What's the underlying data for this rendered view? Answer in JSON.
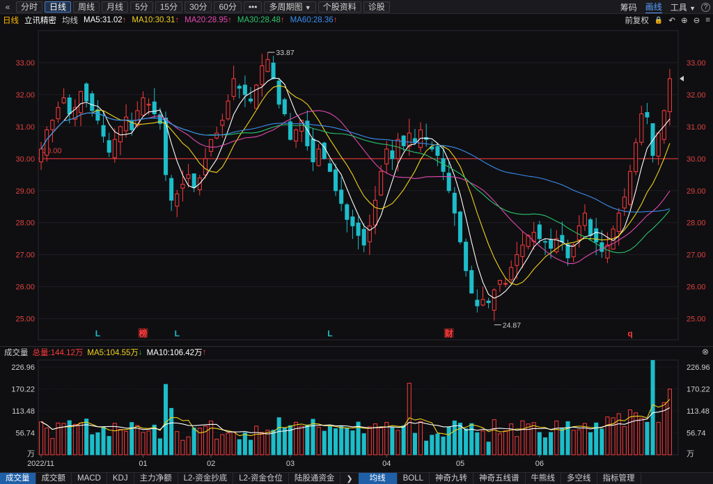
{
  "toolbar": {
    "back_icon": "«",
    "periods": [
      "分时",
      "日线",
      "周线",
      "月线",
      "5分",
      "15分",
      "30分",
      "60分"
    ],
    "active_period": "日线",
    "more": "•••",
    "multi_period": "多周期图",
    "multi_period_arrow": "▼",
    "stock_info": "个股资料",
    "diagnose": "诊股",
    "right_links": [
      "筹码",
      "画线",
      "工具"
    ],
    "active_right": "画线",
    "tools_arrow": "▼",
    "help_icon": "?"
  },
  "ma_row": {
    "period_label": "日线",
    "stock_name": "立讯精密",
    "avg_label": "均线",
    "ma5": "MA5:31.02",
    "ma10": "MA10:30.31",
    "ma20": "MA20:28.95",
    "ma30": "MA30:28.48",
    "ma60": "MA60:28.36",
    "arrow_up": "↑",
    "adjust": "前复权",
    "lock_icon": "🔒",
    "undo_icon": "↶",
    "zoom_in_icon": "⊕",
    "zoom_out_icon": "⊖",
    "menu_icon": "≡"
  },
  "colors": {
    "up": "#ff3b3b",
    "down": "#1dbdc9",
    "ma5": "#ffffff",
    "ma10": "#f2d21b",
    "ma20": "#e449b0",
    "ma30": "#2bc46a",
    "ma60": "#3a8ef0",
    "axis_text": "#e0413e",
    "ref_line": "#ff3b3b"
  },
  "chart_data": {
    "type": "candlestick",
    "y_ticks": [
      "33.00",
      "32.00",
      "31.00",
      "30.00",
      "29.00",
      "28.00",
      "27.00",
      "26.00",
      "25.00"
    ],
    "ylim": [
      24.6,
      34.0
    ],
    "reference_line": 30.0,
    "reference_label": "30.00",
    "max_label": "33.87",
    "min_label": "24.87",
    "x_labels": [
      "2022/11",
      "01",
      "02",
      "03",
      "04",
      "05",
      "06"
    ],
    "markers": [
      {
        "text": "L",
        "color": "#1dbdc9"
      },
      {
        "text": "榜",
        "color": "#ff3b3b"
      },
      {
        "text": "L",
        "color": "#1dbdc9"
      },
      {
        "text": "L",
        "color": "#1dbdc9"
      },
      {
        "text": "财",
        "color": "#ff3b3b"
      },
      {
        "text": "q",
        "color": "#ff3b3b"
      }
    ],
    "closes": [
      30.3,
      30.9,
      31.2,
      31.6,
      31.9,
      31.4,
      31.6,
      32.1,
      31.8,
      31.5,
      31.2,
      30.7,
      30.2,
      30.6,
      31.0,
      31.3,
      30.9,
      31.5,
      31.9,
      31.7,
      31.4,
      31.1,
      29.5,
      28.7,
      28.9,
      29.2,
      29.5,
      29.1,
      29.4,
      30.0,
      30.6,
      30.8,
      31.2,
      31.8,
      32.5,
      32.2,
      32.0,
      31.8,
      32.3,
      32.9,
      33.1,
      32.5,
      31.7,
      31.4,
      30.6,
      30.9,
      31.2,
      30.4,
      29.9,
      30.3,
      30.0,
      29.6,
      29.0,
      28.6,
      28.1,
      27.9,
      27.6,
      27.3,
      27.9,
      28.7,
      29.6,
      30.3,
      30.0,
      30.6,
      30.4,
      30.8,
      30.5,
      30.9,
      30.6,
      30.3,
      30.1,
      29.6,
      29.0,
      28.3,
      27.4,
      26.5,
      25.8,
      25.4,
      25.6,
      25.5,
      25.9,
      26.2,
      26.1,
      26.6,
      27.0,
      27.3,
      27.6,
      27.7,
      27.5,
      27.4,
      27.2,
      27.5,
      27.4,
      26.9,
      27.3,
      27.9,
      28.3,
      27.6,
      27.4,
      27.1,
      27.3,
      27.8,
      28.3,
      28.8,
      29.6,
      30.5,
      31.4,
      31.3,
      30.1,
      30.8,
      31.5,
      32.5
    ],
    "volume": {
      "y_ticks": [
        "226.96",
        "170.22",
        "113.48",
        "56.74",
        "万"
      ],
      "ylim": [
        0,
        245
      ],
      "header_label": "成交量",
      "total": "总量:144.12万",
      "ma5": "MA5:104.55万",
      "ma10": "MA10:106.42万",
      "ma5_arrow": "↓",
      "ma10_arrow": "↑",
      "close_icon": "⊗"
    }
  },
  "bottom_tabs": [
    "成交量",
    "成交额",
    "MACD",
    "KDJ",
    "主力净额",
    "L2-资金抄底",
    "L2-资金仓位",
    "陆股通资金"
  ],
  "bottom_arrow": "❯",
  "bottom_tabs_right": [
    "均线",
    "BOLL",
    "神奇九转",
    "神奇五线谱",
    "牛熊线",
    "多空线",
    "指标管理"
  ],
  "active_bottom": "成交量",
  "active_bottom_right": "均线"
}
